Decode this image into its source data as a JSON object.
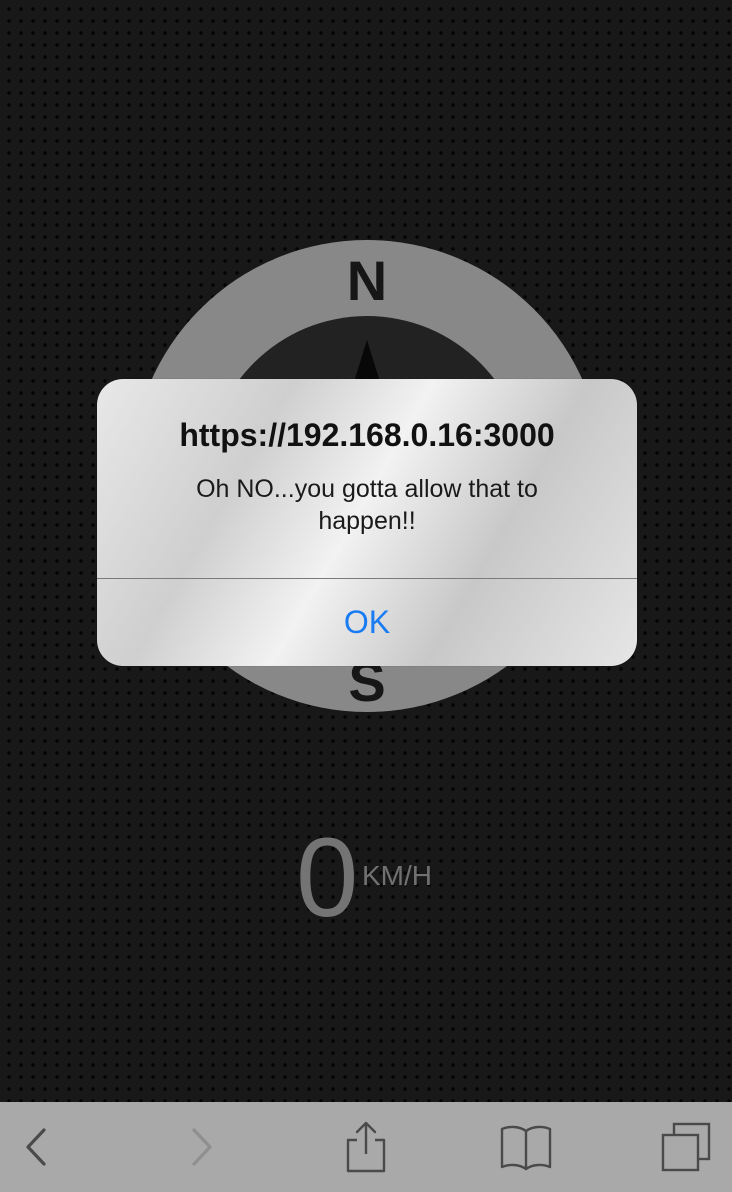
{
  "compass": {
    "north_label": "N",
    "south_label": "S"
  },
  "speedometer": {
    "value": "0",
    "unit": "KM/H"
  },
  "alert": {
    "title": "https://192.168.0.16:3000",
    "message": "Oh NO...you gotta allow that to happen!!",
    "ok_label": "OK"
  },
  "toolbar": {
    "items": [
      {
        "icon": "chevron-left-icon",
        "enabled": true
      },
      {
        "icon": "chevron-right-icon",
        "enabled": false
      },
      {
        "icon": "share-icon",
        "enabled": true
      },
      {
        "icon": "bookmarks-icon",
        "enabled": true
      },
      {
        "icon": "tabs-icon",
        "enabled": true
      }
    ]
  },
  "colors": {
    "alert_button": "#1a7cf2",
    "toolbar_background": "#a9a9a9",
    "compass_ring": "#a6a6a6"
  }
}
